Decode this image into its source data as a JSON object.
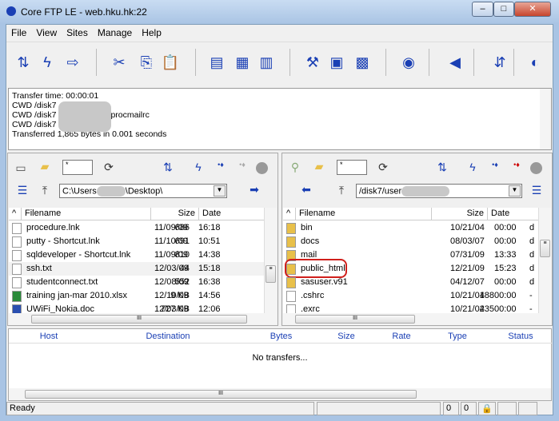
{
  "window": {
    "title": "Core FTP LE - web.hku.hk:22",
    "minimize": "–",
    "maximize": "□",
    "close": "✕"
  },
  "menu": [
    "File",
    "View",
    "Sites",
    "Manage",
    "Help"
  ],
  "toolbar_icons": [
    "connect-transfer-icon",
    "quick-connect-icon",
    "transfer-arrows-icon",
    "cut-icon",
    "copy-icon",
    "paste-icon",
    "view-icon",
    "binary-icon",
    "ascii-icon",
    "site-manager-icon",
    "queue-icon",
    "terminal-icon",
    "view-eye-icon",
    "sound-icon",
    "sync-icon",
    "help-icon"
  ],
  "log": [
    "Transfer time: 00:00:01",
    "CWD /disk7",
    "CWD /disk7",
    "CWD /disk7",
    "Transferred 1,865 bytes in 0.001 seconds"
  ],
  "log_suffix": "procmailrc",
  "local": {
    "filter": "*",
    "path": "C:\\Users",
    "path_tail": "\\Desktop\\",
    "columns": [
      "Filename",
      "Size",
      "Date"
    ],
    "files": [
      {
        "name": "procedure.lnk",
        "size": "686",
        "date": "11/09/09",
        "time": "16:18",
        "type": "shortcut"
      },
      {
        "name": "putty - Shortcut.lnk",
        "size": "691",
        "date": "11/10/09",
        "time": "10:51",
        "type": "shortcut"
      },
      {
        "name": "sqldeveloper - Shortcut.lnk",
        "size": "810",
        "date": "11/09/09",
        "time": "14:38",
        "type": "shortcut"
      },
      {
        "name": "ssh.txt",
        "size": "44",
        "date": "12/03/09",
        "time": "15:18",
        "type": "text"
      },
      {
        "name": "studentconnect.txt",
        "size": "552",
        "date": "12/08/09",
        "time": "16:38",
        "type": "text"
      },
      {
        "name": "training jan-mar 2010.xlsx",
        "size": "9 KB",
        "date": "12/10/09",
        "time": "14:56",
        "type": "excel"
      },
      {
        "name": "UWiFi_Nokia.doc",
        "size": "727 KB",
        "date": "12/03/09",
        "time": "12:06",
        "type": "word"
      }
    ]
  },
  "remote": {
    "filter": "*",
    "path": "/disk7/user",
    "columns": [
      "Filename",
      "Size",
      "Date"
    ],
    "files": [
      {
        "name": "bin",
        "size": "",
        "date": "10/21/04",
        "time": "00:00",
        "perm": "d",
        "type": "folder"
      },
      {
        "name": "docs",
        "size": "",
        "date": "08/03/07",
        "time": "00:00",
        "perm": "d",
        "type": "folder"
      },
      {
        "name": "mail",
        "size": "",
        "date": "07/31/09",
        "time": "13:33",
        "perm": "d",
        "type": "folder"
      },
      {
        "name": "public_html",
        "size": "",
        "date": "12/21/09",
        "time": "15:23",
        "perm": "d",
        "type": "folder",
        "highlighted": true
      },
      {
        "name": "sasuser.v91",
        "size": "",
        "date": "04/12/07",
        "time": "00:00",
        "perm": "d",
        "type": "folder"
      },
      {
        "name": ".cshrc",
        "size": "188",
        "date": "10/21/04",
        "time": "00:00",
        "perm": "-",
        "type": "file"
      },
      {
        "name": ".exrc",
        "size": "235",
        "date": "10/21/04",
        "time": "00:00",
        "perm": "-",
        "type": "file"
      }
    ]
  },
  "transfers": {
    "columns": [
      "Host",
      "Destination",
      "Bytes",
      "Size",
      "Rate",
      "Type",
      "Status"
    ],
    "empty": "No transfers..."
  },
  "status": {
    "text": "Ready",
    "count1": "0",
    "count2": "0"
  },
  "colors": {
    "accent": "#1a3fb4",
    "highlight": "#d0201c",
    "folder": "#e8c04a"
  }
}
